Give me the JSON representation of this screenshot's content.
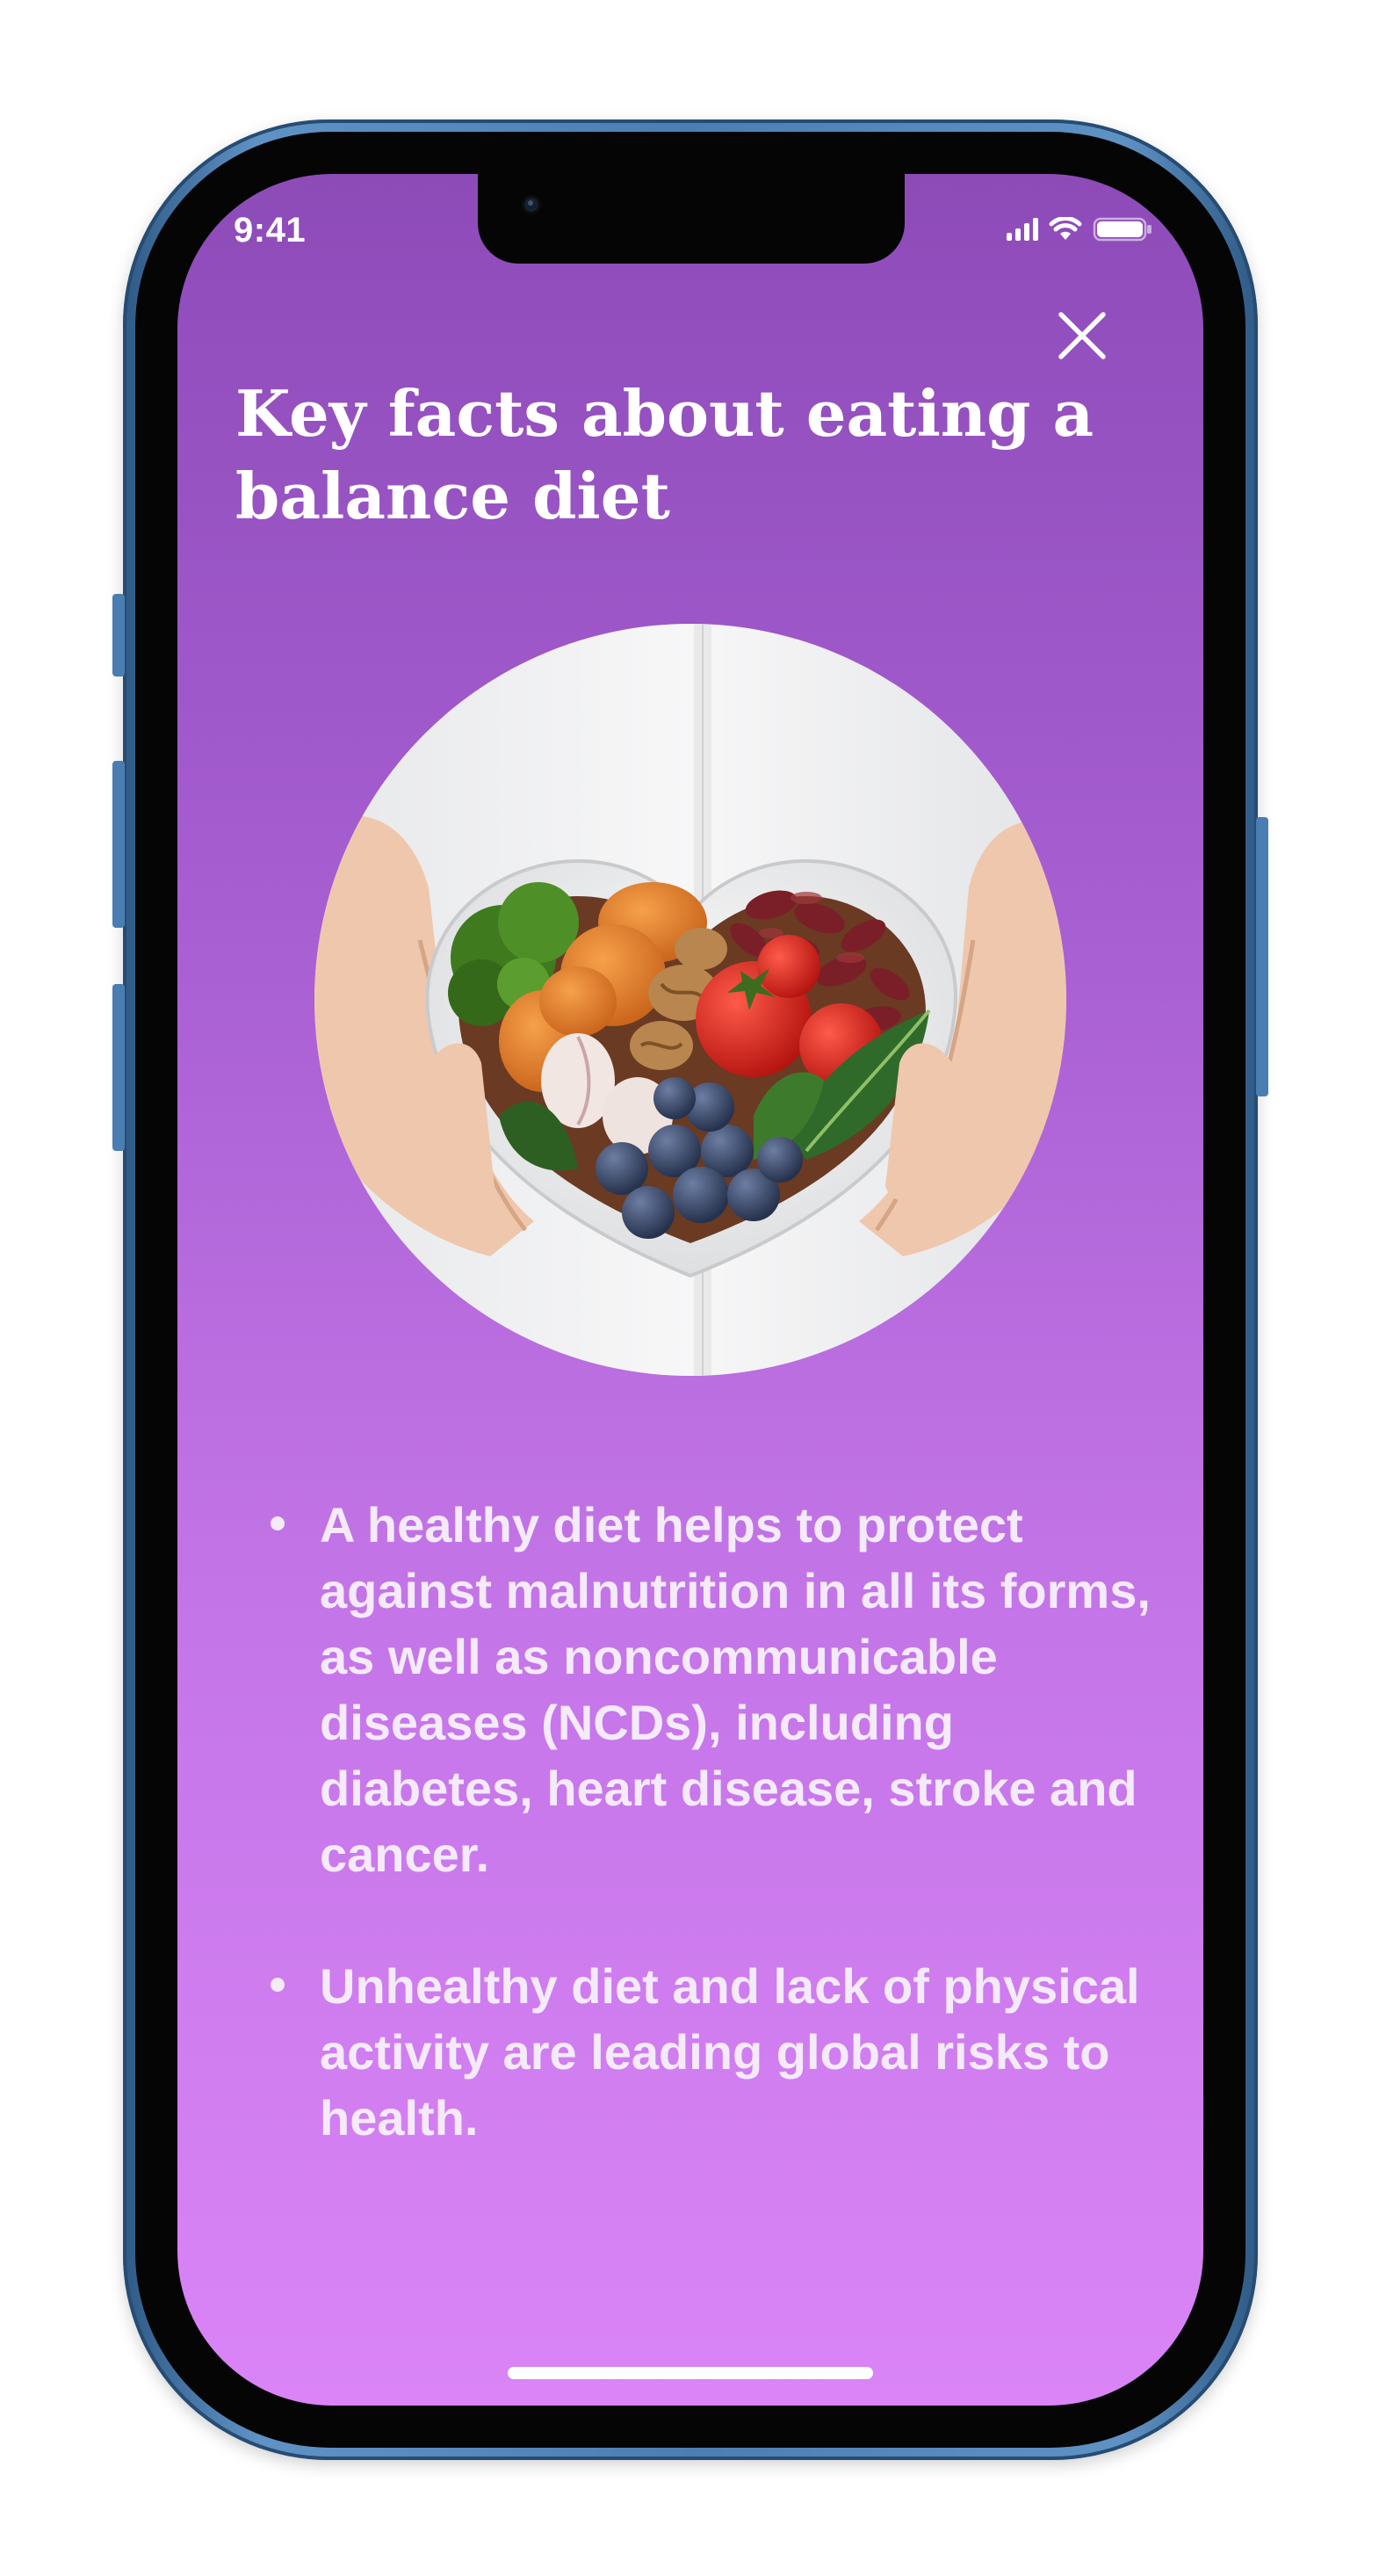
{
  "status_bar": {
    "time": "9:41"
  },
  "header": {
    "close_icon": "close-icon",
    "title": "Key facts about eating a balance diet"
  },
  "hero": {
    "icon": "heart-bowl-food-photo"
  },
  "facts": [
    "A healthy diet helps to protect against malnutrition in all its forms, as well as noncommunicable diseases (NCDs), including diabetes, heart disease, stroke and cancer.",
    "Unhealthy diet and lack of physical activity are leading global risks to health."
  ],
  "colors": {
    "gradient_top": "#8d4bb8",
    "gradient_bottom": "#da84f7",
    "text": "#ffffff",
    "phone_frame": "#4b7fb3"
  }
}
